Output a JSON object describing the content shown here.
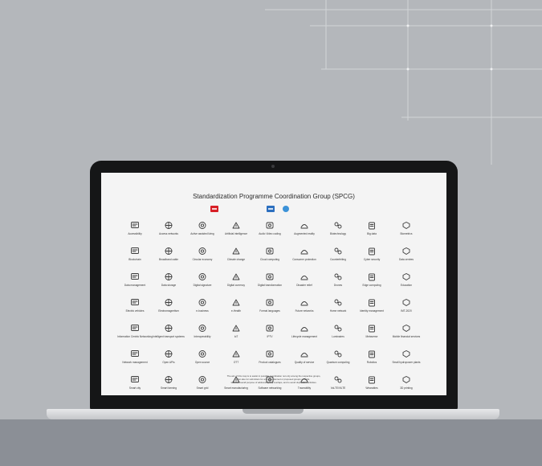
{
  "title": "Standardization Programme Coordination Group (SPCG)",
  "rows": [
    [
      "Accessibility",
      "Access networks",
      "Active assisted living",
      "Artificial intelligence",
      "Audio Video coding",
      "Augmented reality",
      "Biotechnology",
      "Big data",
      "Biometrics"
    ],
    [
      "Blockchain",
      "Broadband cable",
      "Circular economy",
      "Climate change",
      "Cloud computing",
      "Consumer protection",
      "Counterfeiting",
      "Cyber security",
      "Data centres"
    ],
    [
      "Data management",
      "Data storage",
      "Digital signature",
      "Digital currency",
      "Digital transformation",
      "Disaster relief",
      "Drones",
      "Edge computing",
      "Education"
    ],
    [
      "Electric vehicles",
      "Electromagnetism",
      "e-business",
      "e-Health",
      "Formal languages",
      "Future networks",
      "Home network",
      "Identity management",
      "IMT-2020"
    ],
    [
      "Information Centric Networking",
      "Intelligent transport systems",
      "Interoperability",
      "IoT",
      "IPTV",
      "Lifecycle management",
      "Luminaires",
      "Metaverse",
      "Mobile financial services"
    ],
    [
      "Network management",
      "Open APIs",
      "Open source",
      "OTT",
      "Product catalogues",
      "Quality of service",
      "Quantum computing",
      "Robotics",
      "Small hydropower plants"
    ],
    [
      "Smart city",
      "Smart farming",
      "Smart grid",
      "Smart manufacturing",
      "Software networking",
      "Traceability",
      "VoLTE/ViLTE",
      "Wearables",
      "3D printing"
    ]
  ],
  "footnote": [
    "The aim of this map is to assist in possible coordination not only among the respective groups,",
    "but also for submitters for any new planned or proposed groups or fields,",
    "with the overall purpose of addressing any overlaps, and to avoid duplicative activities."
  ]
}
